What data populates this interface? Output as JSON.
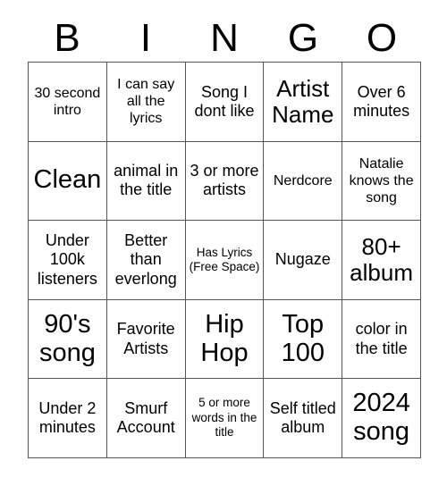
{
  "header": {
    "letters": [
      "B",
      "I",
      "N",
      "G",
      "O"
    ]
  },
  "colors": {
    "grid_line": "#555555",
    "cell_background": "#ffffff",
    "text": "#000000",
    "page_background": "#ffffff"
  },
  "grid": {
    "columns": 5,
    "rows": 5,
    "cells": [
      {
        "text": "30 second intro",
        "size": "sm"
      },
      {
        "text": "I can say all the lyrics",
        "size": "sm"
      },
      {
        "text": "Song I dont like",
        "size": "md"
      },
      {
        "text": "Artist Name",
        "size": "xl"
      },
      {
        "text": "Over 6 minutes",
        "size": "md"
      },
      {
        "text": "Clean",
        "size": "xxl"
      },
      {
        "text": "animal in the title",
        "size": "md"
      },
      {
        "text": "3 or more artists",
        "size": "md"
      },
      {
        "text": "Nerdcore",
        "size": "sm"
      },
      {
        "text": "Natalie knows the song",
        "size": "sm"
      },
      {
        "text": "Under 100k listeners",
        "size": "md"
      },
      {
        "text": "Better than everlong",
        "size": "md"
      },
      {
        "text": "Has Lyrics (Free Space)",
        "size": "xs"
      },
      {
        "text": "Nugaze",
        "size": "md"
      },
      {
        "text": "80+ album",
        "size": "xl"
      },
      {
        "text": "90's song",
        "size": "xxl"
      },
      {
        "text": "Favorite Artists",
        "size": "md"
      },
      {
        "text": "Hip Hop",
        "size": "xxl"
      },
      {
        "text": "Top 100",
        "size": "xxl"
      },
      {
        "text": "color in the title",
        "size": "md"
      },
      {
        "text": "Under 2 minutes",
        "size": "md"
      },
      {
        "text": "Smurf Account",
        "size": "md"
      },
      {
        "text": "5 or more words in the title",
        "size": "xs"
      },
      {
        "text": "Self titled album",
        "size": "md"
      },
      {
        "text": "2024 song",
        "size": "xxl"
      }
    ]
  }
}
